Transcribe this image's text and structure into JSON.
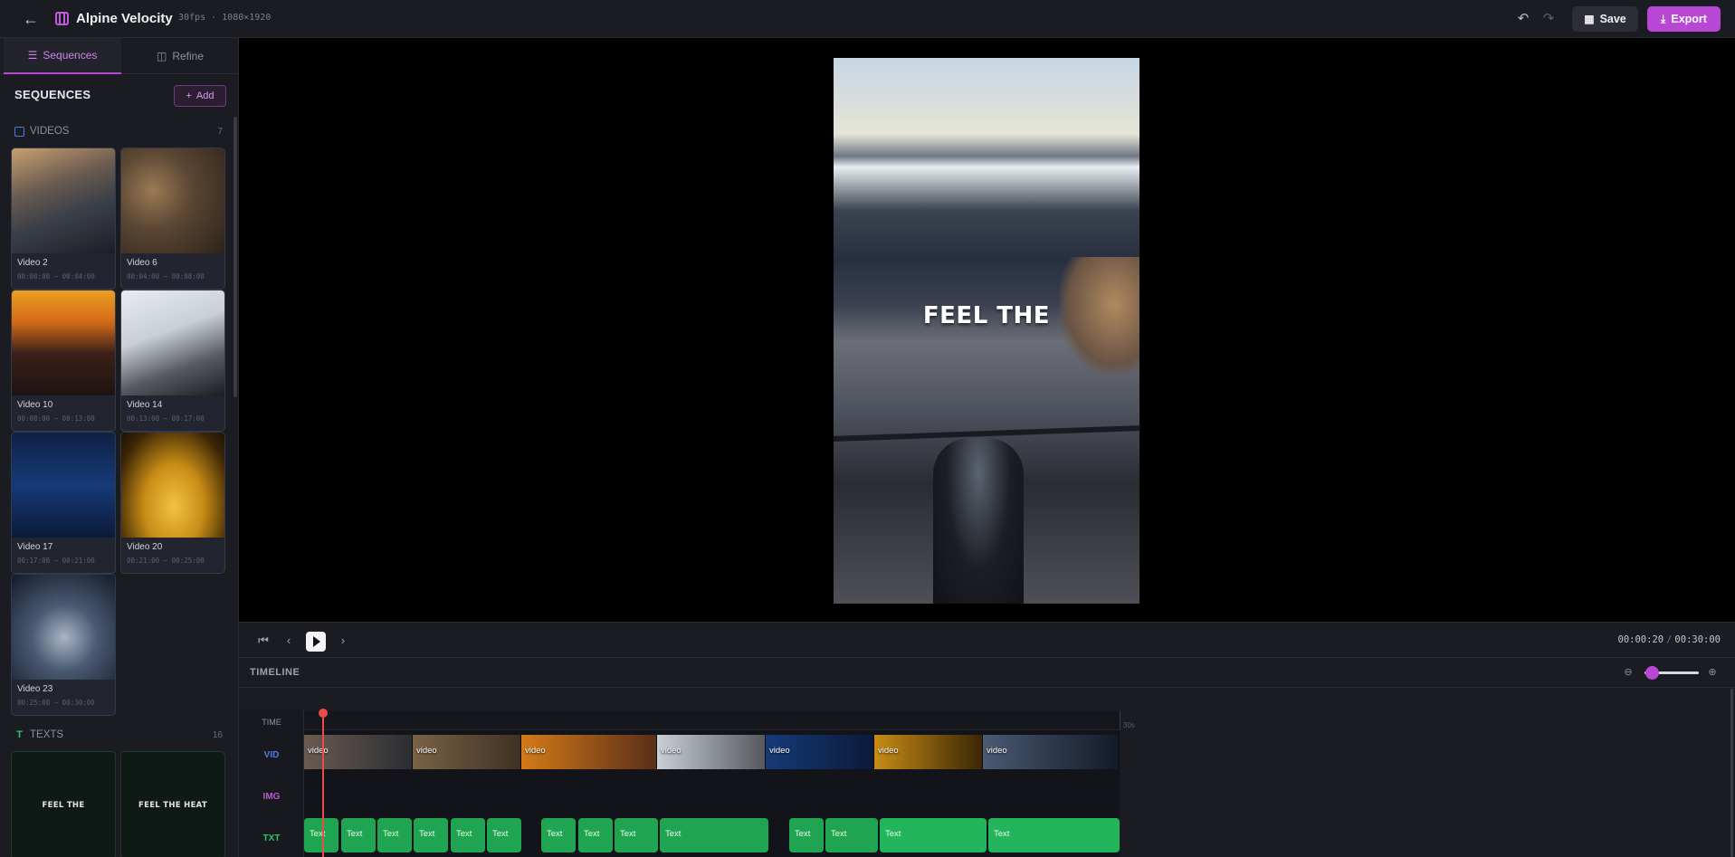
{
  "header": {
    "title": "Alpine Velocity",
    "meta": "30fps · 1080×1920",
    "save_label": "Save",
    "export_label": "Export"
  },
  "sidebar": {
    "tabs": [
      {
        "label": "Sequences",
        "active": true
      },
      {
        "label": "Refine",
        "active": false
      }
    ],
    "heading": "SEQUENCES",
    "add_label": "Add",
    "videos_label": "VIDEOS",
    "videos_count": "7",
    "videos": [
      {
        "name": "Video 2",
        "time": "00:00:00 – 00:04:00"
      },
      {
        "name": "Video 6",
        "time": "00:04:00 – 00:08:00"
      },
      {
        "name": "Video 10",
        "time": "00:08:00 – 00:13:00"
      },
      {
        "name": "Video 14",
        "time": "00:13:00 – 00:17:00"
      },
      {
        "name": "Video 17",
        "time": "00:17:00 – 00:21:00"
      },
      {
        "name": "Video 20",
        "time": "00:21:00 – 00:25:00"
      },
      {
        "name": "Video 23",
        "time": "00:25:00 – 00:30:00"
      }
    ],
    "texts_label": "TEXTS",
    "texts_count": "16",
    "texts": [
      {
        "content": "FEEL THE"
      },
      {
        "content": "FEEL THE HEAT"
      }
    ]
  },
  "preview": {
    "overlay_text": "FEEL THE"
  },
  "transport": {
    "current_time": "00:00:20",
    "total_time": "00:30:00"
  },
  "timeline": {
    "heading": "TIMELINE",
    "end_label": "30s",
    "track_labels": {
      "time": "TIME",
      "vid": "VID",
      "img": "IMG",
      "txt": "TXT"
    },
    "video_clip_label": "video",
    "text_clip_label": "Text",
    "colors": {
      "vid": "#4a7fe0",
      "img": "#b45ad3",
      "txt": "#2fc269",
      "playhead": "#ea4b4b",
      "accent": "#b847d6"
    }
  }
}
